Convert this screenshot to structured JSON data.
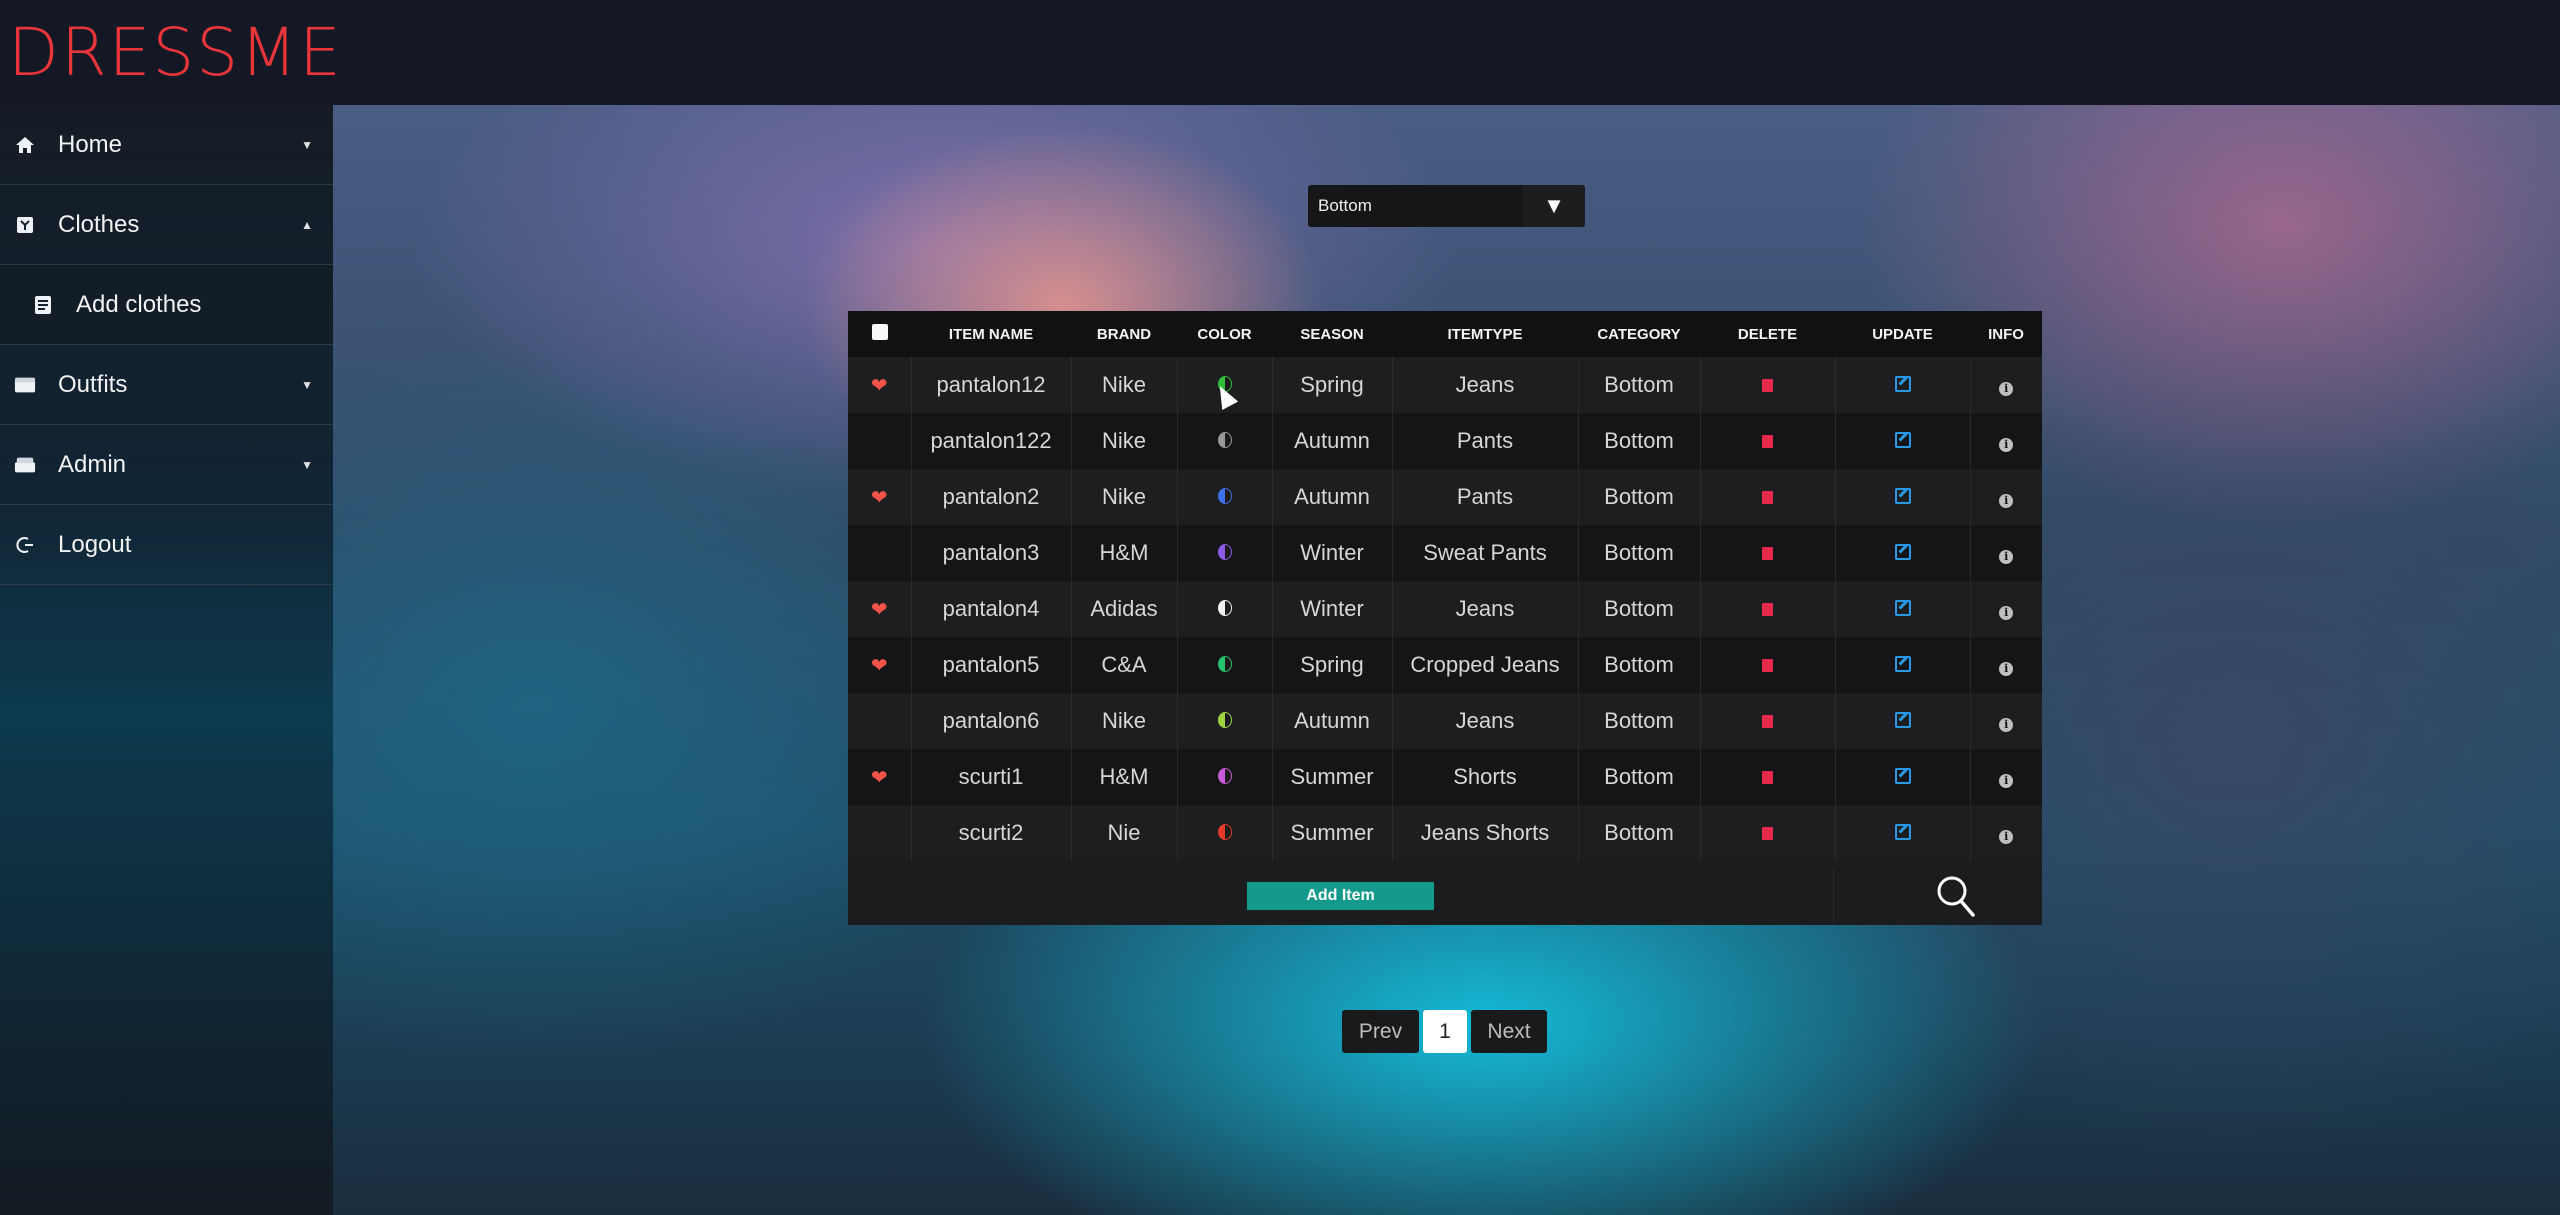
{
  "app": {
    "logo": "DRESSME"
  },
  "sidebar": {
    "items": [
      {
        "label": "Home",
        "icon": "home-icon",
        "caret": "down"
      },
      {
        "label": "Clothes",
        "icon": "shirt-icon",
        "caret": "up"
      },
      {
        "label": "Add clothes",
        "icon": "list-icon"
      },
      {
        "label": "Outfits",
        "icon": "wardrobe-icon",
        "caret": "down"
      },
      {
        "label": "Admin",
        "icon": "admin-icon",
        "caret": "down"
      },
      {
        "label": "Logout",
        "icon": "logout-icon"
      }
    ]
  },
  "filter": {
    "selected": "Bottom"
  },
  "table": {
    "headers": [
      "ITEM NAME",
      "BRAND",
      "COLOR",
      "SEASON",
      "ITEMTYPE",
      "CATEGORY",
      "DELETE",
      "UPDATE",
      "INFO"
    ],
    "rows": [
      {
        "favorite": true,
        "name": "pantalon12",
        "brand": "Nike",
        "color": "#2fbf3a",
        "season": "Spring",
        "type": "Jeans",
        "category": "Bottom"
      },
      {
        "favorite": false,
        "name": "pantalon122",
        "brand": "Nike",
        "color": "#9a9a9a",
        "season": "Autumn",
        "type": "Pants",
        "category": "Bottom"
      },
      {
        "favorite": true,
        "name": "pantalon2",
        "brand": "Nike",
        "color": "#3f6fe8",
        "season": "Autumn",
        "type": "Pants",
        "category": "Bottom"
      },
      {
        "favorite": false,
        "name": "pantalon3",
        "brand": "H&M",
        "color": "#8a5ae6",
        "season": "Winter",
        "type": "Sweat Pants",
        "category": "Bottom"
      },
      {
        "favorite": true,
        "name": "pantalon4",
        "brand": "Adidas",
        "color": "#f0f0f0",
        "season": "Winter",
        "type": "Jeans",
        "category": "Bottom"
      },
      {
        "favorite": true,
        "name": "pantalon5",
        "brand": "C&A",
        "color": "#27c36a",
        "season": "Spring",
        "type": "Cropped Jeans",
        "category": "Bottom"
      },
      {
        "favorite": false,
        "name": "pantalon6",
        "brand": "Nike",
        "color": "#9ad33a",
        "season": "Autumn",
        "type": "Jeans",
        "category": "Bottom"
      },
      {
        "favorite": true,
        "name": "scurti1",
        "brand": "H&M",
        "color": "#c65ad8",
        "season": "Summer",
        "type": "Shorts",
        "category": "Bottom"
      },
      {
        "favorite": false,
        "name": "scurti2",
        "brand": "Nie",
        "color": "#e63a2a",
        "season": "Summer",
        "type": "Jeans Shorts",
        "category": "Bottom"
      }
    ]
  },
  "actions": {
    "add_item": "Add Item"
  },
  "pagination": {
    "prev": "Prev",
    "current": "1",
    "next": "Next"
  }
}
